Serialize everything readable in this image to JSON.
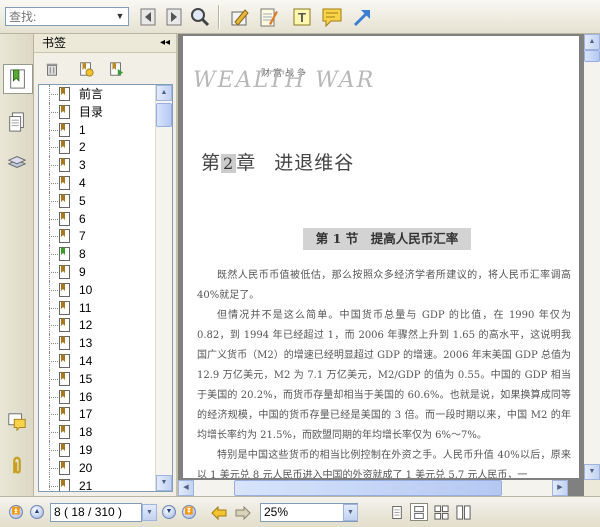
{
  "toolbar": {
    "search_placeholder": "查找:",
    "icons": [
      "search-back-icon",
      "search-forward-icon",
      "search-magnifier-icon",
      "highlight-pen-icon",
      "note-pad-icon",
      "text-tool-icon",
      "comment-icon",
      "arrow-tool-icon"
    ]
  },
  "side_tabs": [
    "bookmark-tab-icon",
    "pages-tab-icon",
    "layers-tab-icon",
    "comments-tab-icon",
    "attachments-tab-icon"
  ],
  "bookmarks_panel": {
    "title": "书签",
    "collapse_glyph": "◂◂",
    "items": [
      {
        "label": "前言"
      },
      {
        "label": "目录"
      },
      {
        "label": "1"
      },
      {
        "label": "2"
      },
      {
        "label": "3"
      },
      {
        "label": "4"
      },
      {
        "label": "5"
      },
      {
        "label": "6"
      },
      {
        "label": "7"
      },
      {
        "label": "8",
        "selected": true
      },
      {
        "label": "9"
      },
      {
        "label": "10"
      },
      {
        "label": "11"
      },
      {
        "label": "12"
      },
      {
        "label": "13"
      },
      {
        "label": "14"
      },
      {
        "label": "15"
      },
      {
        "label": "16"
      },
      {
        "label": "17"
      },
      {
        "label": "18"
      },
      {
        "label": "19"
      },
      {
        "label": "20"
      },
      {
        "label": "21"
      }
    ]
  },
  "document": {
    "logo_sub": "财富战争",
    "logo": "WEALTH WAR",
    "chapter_prefix": "第",
    "chapter_num": "2",
    "chapter_suffix": "章",
    "chapter_title": "进退维谷",
    "section_title": "第 1 节　提高人民币汇率",
    "paragraphs": [
      "既然人民币币值被低估，那么按照众多经济学者所建议的，将人民币汇率调高 40%就足了。",
      "但情况并不是这么简单。中国货币总量与 GDP 的比值，在 1990 年仅为 0.82，到 1994 年已经超过 1，而 2006 年骤然上升到 1.65 的高水平，这说明我国广义货币（M2）的增速已经明显超过 GDP 的增速。2006 年末美国 GDP 总值为 12.9 万亿美元，M2 为 7.1 万亿美元，M2/GDP 的值为 0.55。中国的 GDP 相当于美国的 20.2%，而货币存量却相当于美国的 60.6%。也就是说，如果换算成同等的经济规模，中国的货币存量已经是美国的 3 倍。而一段时期以来，中国 M2 的年均增长率约为 21.5%，而欧盟同期的年均增长率仅为 6%～7%。",
      "特别是中国这些货币的相当比例控制在外资之手。人民币升值 40%以后，原来以 1 美元兑 8 元人民币进入中国的外资就成了 1 美元兑 5.7 元人民币，一"
    ]
  },
  "status": {
    "page_field": "8 ( 18 / 310 )",
    "zoom": "25%"
  }
}
